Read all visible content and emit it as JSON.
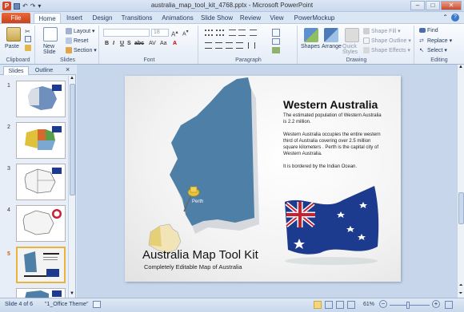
{
  "window": {
    "title": "australia_map_tool_kit_4768.pptx - Microsoft PowerPoint",
    "minimize": "–",
    "maximize": "□",
    "close": "✕"
  },
  "ribbon_tabs": [
    "File",
    "Home",
    "Insert",
    "Design",
    "Transitions",
    "Animations",
    "Slide Show",
    "Review",
    "View",
    "PowerMockup"
  ],
  "ribbon": {
    "clipboard": {
      "paste": "Paste",
      "label": "Clipboard"
    },
    "slides": {
      "new_slide": "New Slide",
      "layout": "Layout",
      "reset": "Reset",
      "section": "Section",
      "label": "Slides"
    },
    "font": {
      "size": "18",
      "label": "Font"
    },
    "paragraph": {
      "label": "Paragraph"
    },
    "drawing": {
      "shapes": "Shapes",
      "arrange": "Arrange",
      "quick_styles": "Quick Styles",
      "shape_fill": "Shape Fill",
      "shape_outline": "Shape Outline",
      "shape_effects": "Shape Effects",
      "label": "Drawing"
    },
    "editing": {
      "find": "Find",
      "replace": "Replace",
      "select": "Select",
      "label": "Editing"
    }
  },
  "panel": {
    "tabs": [
      "Slides",
      "Outline"
    ],
    "close": "×",
    "slide_numbers": [
      "1",
      "2",
      "3",
      "4",
      "5"
    ]
  },
  "slide": {
    "heading": "Western Australia",
    "para1": "The estimated population of Western Australia is 2.2 million.",
    "para2": "Western Australia occupies the entire western third of Australia covering over 2.5 million square kilometers . Perth is the capital city of Western Australia.",
    "para3": "It is bordered by the Indian Ocean.",
    "pin_label": "Perth",
    "kit_title": "Australia Map Tool Kit",
    "kit_subtitle": "Completely Editable Map of Australia"
  },
  "status": {
    "slide_indicator": "Slide 4 of 6",
    "theme": "\"1_Office Theme\"",
    "zoom": "61%"
  },
  "colors": {
    "map_blue": "#4e7fa7",
    "flag_blue": "#1d3b8e",
    "file_tab": "#d24726",
    "selection": "#e8b43a"
  }
}
